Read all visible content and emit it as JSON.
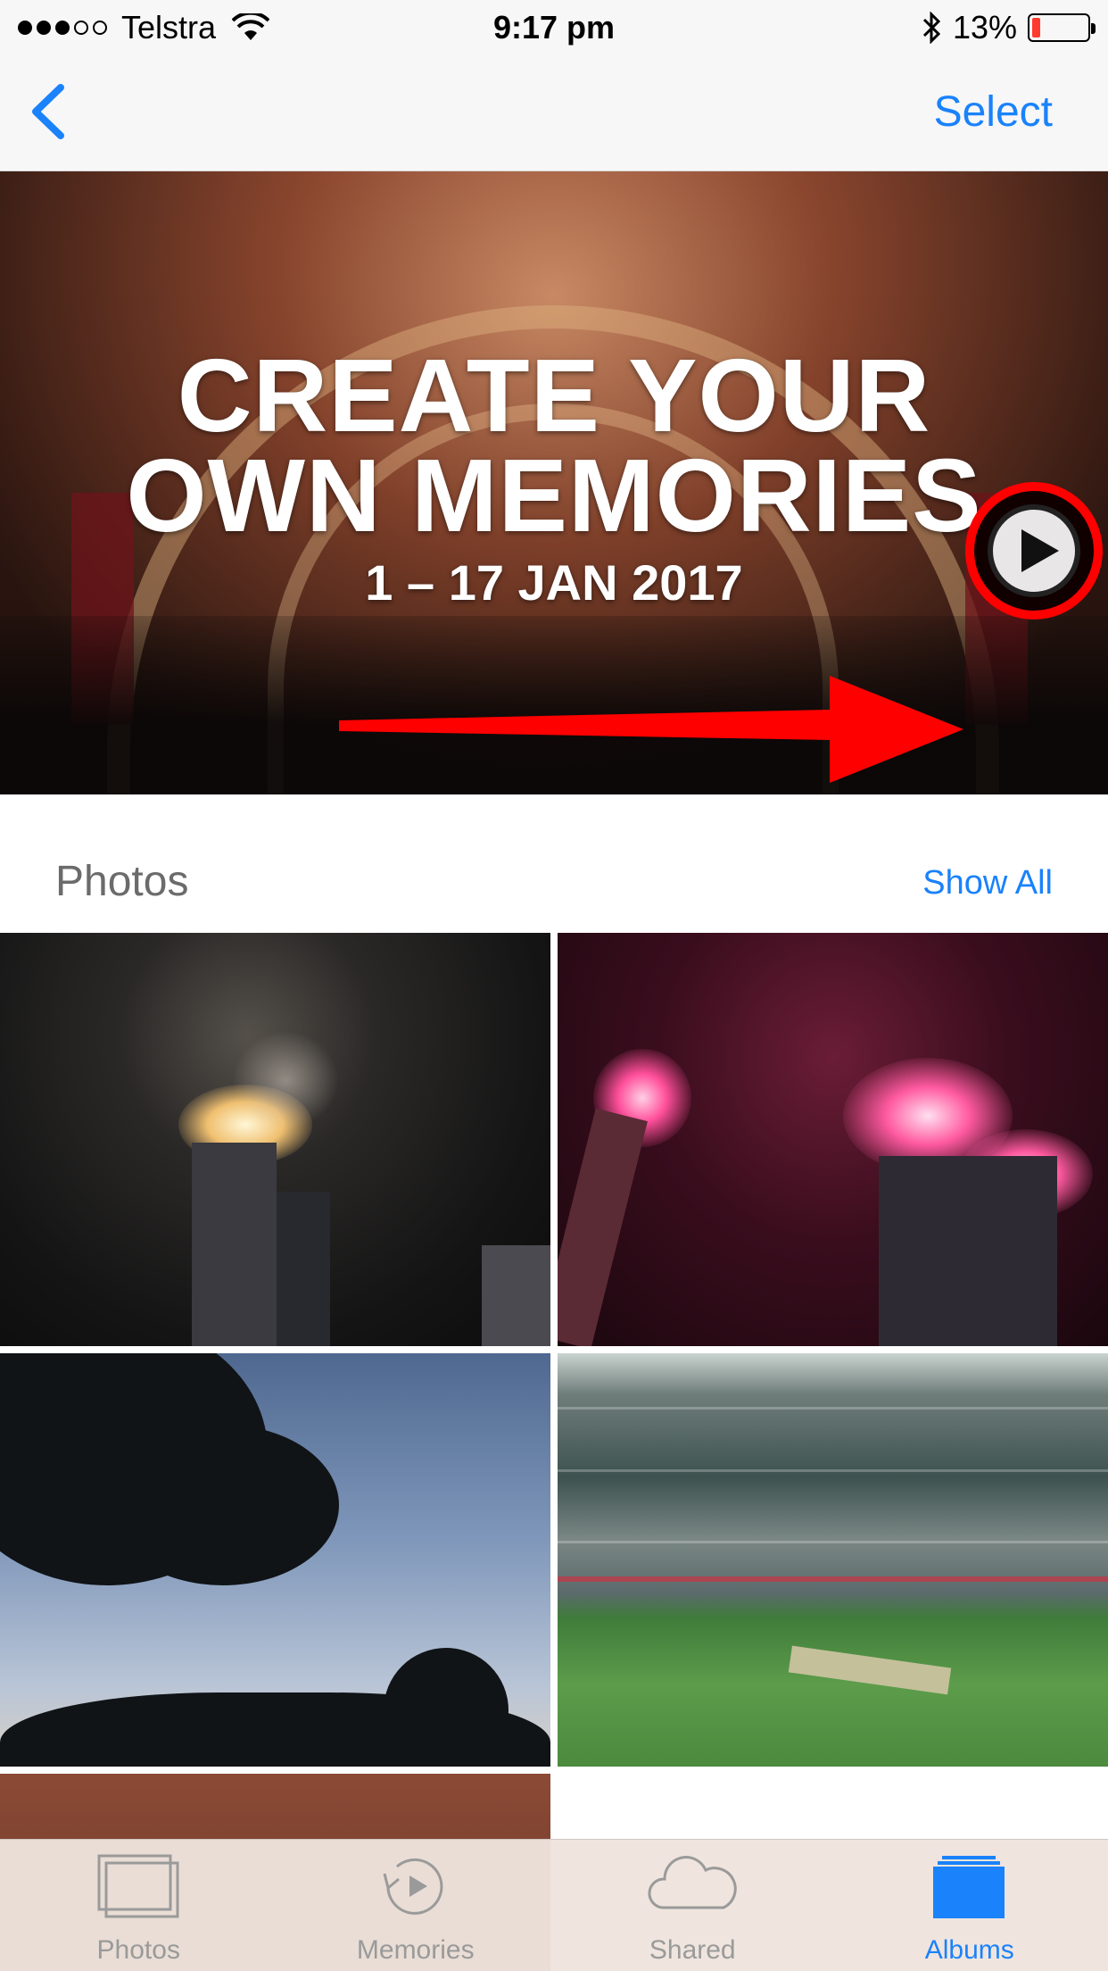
{
  "status_bar": {
    "carrier": "Telstra",
    "time": "9:17 pm",
    "battery": "13%",
    "battery_level_percent": 13,
    "signal_bars_filled": 3,
    "signal_bars_total": 5
  },
  "nav": {
    "select_label": "Select"
  },
  "memory": {
    "title_line1": "CREATE YOUR",
    "title_line2": "OWN MEMORIES",
    "date_range": "1 – 17 JAN 2017"
  },
  "photos_section": {
    "title": "Photos",
    "show_all_label": "Show All"
  },
  "tabs": [
    {
      "label": "Photos",
      "icon": "photos-icon",
      "active": false
    },
    {
      "label": "Memories",
      "icon": "memories-icon",
      "active": false
    },
    {
      "label": "Shared",
      "icon": "cloud-icon",
      "active": false
    },
    {
      "label": "Albums",
      "icon": "albums-icon",
      "active": true
    }
  ],
  "colors": {
    "accent": "#1a82fb",
    "annotation": "#ff0000",
    "battery_low": "#ff3b30"
  }
}
